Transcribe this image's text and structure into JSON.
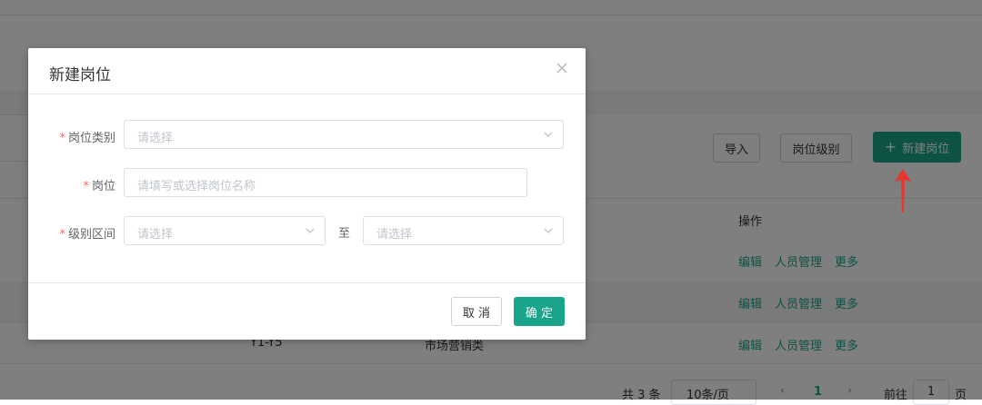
{
  "background": {
    "import_button": "导入",
    "level_button": "岗位级别",
    "new_button": "新建岗位",
    "operation_header": "操作",
    "rows": [
      {
        "level": "",
        "category": "",
        "actions": [
          "编辑",
          "人员管理",
          "更多"
        ]
      },
      {
        "level": "",
        "category": "",
        "actions": [
          "编辑",
          "人员管理",
          "更多"
        ]
      },
      {
        "level": "Y1-Y5",
        "category": "市场营销类",
        "actions": [
          "编辑",
          "人员管理",
          "更多"
        ]
      }
    ],
    "pagination": {
      "total": "共 3 条",
      "page_size": "10条/页",
      "current_page": "1",
      "goto_prefix": "前往",
      "goto_value": "1",
      "goto_suffix": "页"
    }
  },
  "dialog": {
    "title": "新建岗位",
    "fields": {
      "category": {
        "label": "岗位类别",
        "placeholder": "请选择"
      },
      "position": {
        "label": "岗位",
        "placeholder": "请填写或选择岗位名称"
      },
      "level_range": {
        "label": "级别区间",
        "from_placeholder": "请选择",
        "separator": "至",
        "to_placeholder": "请选择"
      }
    },
    "required_mark": "*",
    "cancel_label": "取 消",
    "confirm_label": "确 定"
  },
  "colors": {
    "accent": "#1aa58a",
    "required": "#f56c6c",
    "annotation": "#e8352e"
  }
}
